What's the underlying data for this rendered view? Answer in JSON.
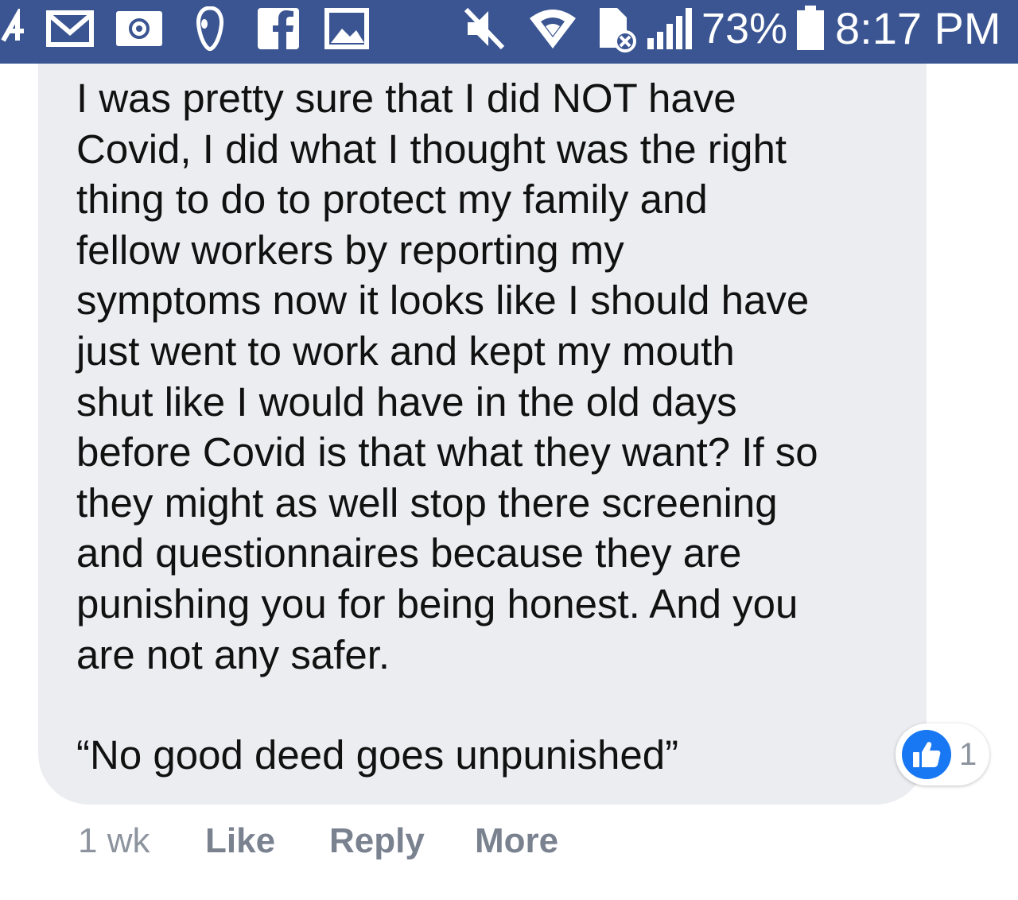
{
  "status_bar": {
    "battery": "73%",
    "time": "8:17 PM",
    "icons": [
      "arrow-icon",
      "gmail-icon",
      "email-icon",
      "alien-icon",
      "facebook-icon",
      "gallery-icon",
      "mute-icon",
      "wifi-icon",
      "data-off-icon",
      "signal-icon",
      "battery-icon"
    ],
    "bar_color": "#3b5592"
  },
  "comment": {
    "lines": [
      "I was pretty sure that I did NOT have",
      "Covid, I did what I thought was the right",
      "thing to do to protect my family and",
      "fellow workers by reporting my",
      "symptoms now it looks like I should have",
      "just went to work and kept my mouth",
      "shut like I would have in the old days",
      "before Covid is that what they want? If so",
      "they might as well stop there screening",
      "and questionnaires because they are",
      "punishing you for being honest. And you",
      "are not any safer."
    ],
    "quote": "“No good deed goes unpunished”",
    "bubble_color": "#ecedf1"
  },
  "reaction": {
    "type": "like-icon",
    "count": "1",
    "color": "#1877f2"
  },
  "actions": {
    "time_ago": "1 wk",
    "like": "Like",
    "reply": "Reply",
    "more": "More"
  }
}
